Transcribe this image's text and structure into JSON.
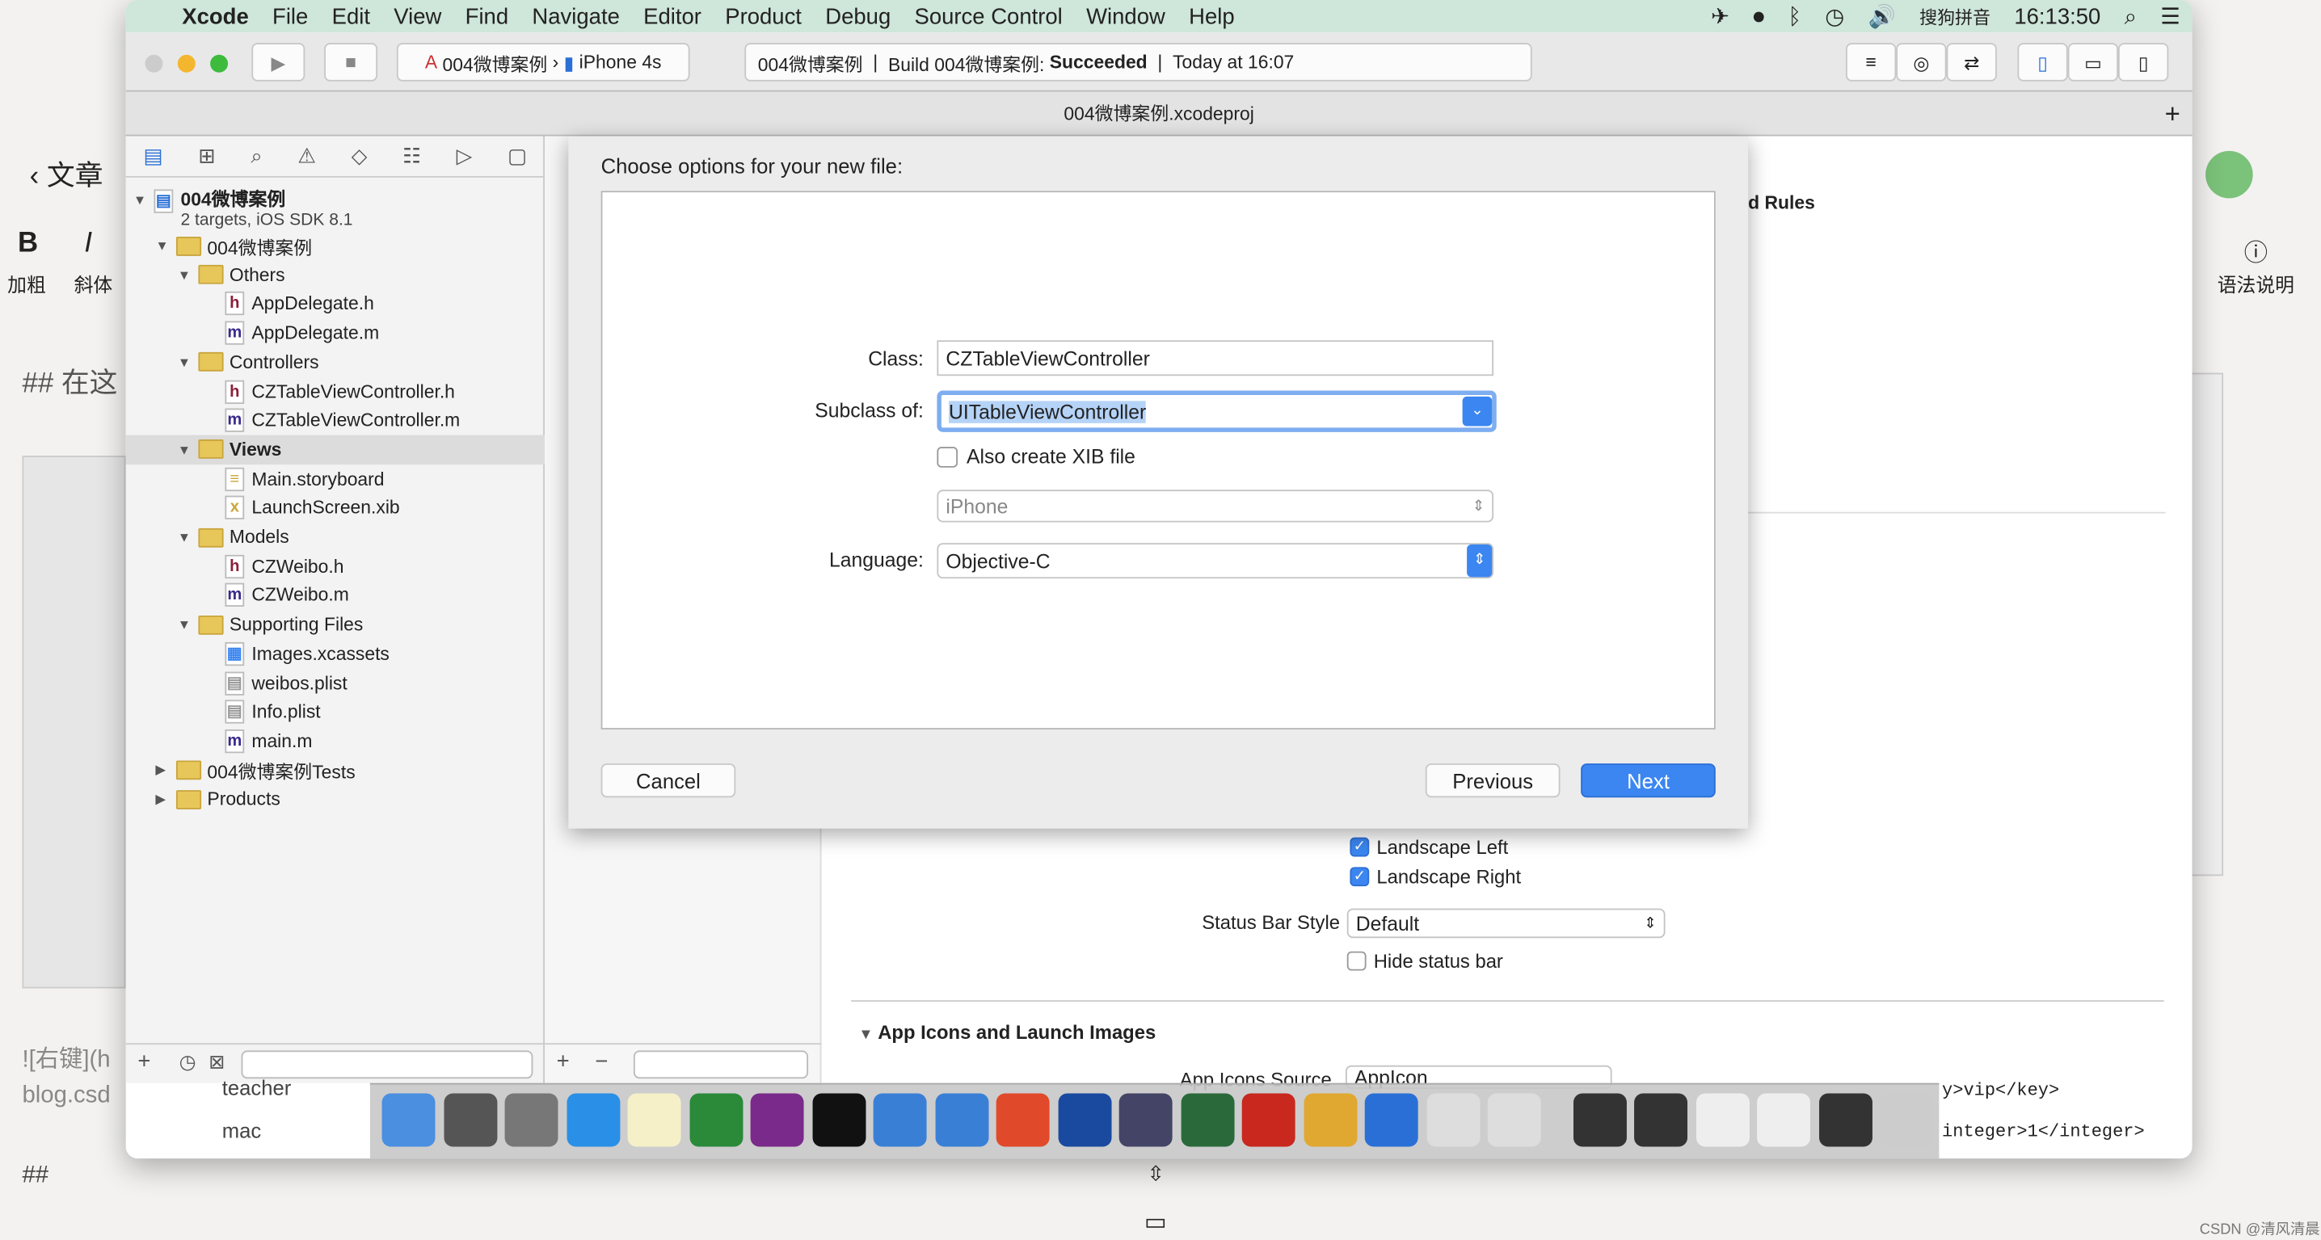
{
  "menubar": {
    "apple": "",
    "items": [
      "Xcode",
      "File",
      "Edit",
      "View",
      "Find",
      "Navigate",
      "Editor",
      "Product",
      "Debug",
      "Source Control",
      "Window",
      "Help"
    ],
    "input_method": "搜狗拼音",
    "clock": "16:13:50"
  },
  "toolbar": {
    "scheme": "004微博案例",
    "device": "iPhone 4s",
    "status_project": "004微博案例",
    "status_build": "Build 004微博案例:",
    "status_result": "Succeeded",
    "status_time": "Today at 16:07"
  },
  "window_title": "004微博案例.xcodeproj",
  "navigator": {
    "project": "004微博案例",
    "project_sub": "2 targets, iOS SDK 8.1",
    "items": [
      {
        "label": "004微博案例",
        "type": "folder",
        "level": 1,
        "open": true
      },
      {
        "label": "Others",
        "type": "folder",
        "level": 2,
        "open": true
      },
      {
        "label": "AppDelegate.h",
        "type": "h",
        "level": 3
      },
      {
        "label": "AppDelegate.m",
        "type": "m",
        "level": 3
      },
      {
        "label": "Controllers",
        "type": "folder",
        "level": 2,
        "open": true
      },
      {
        "label": "CZTableViewController.h",
        "type": "h",
        "level": 3
      },
      {
        "label": "CZTableViewController.m",
        "type": "m",
        "level": 3
      },
      {
        "label": "Views",
        "type": "folder",
        "level": 2,
        "open": true,
        "selected": true
      },
      {
        "label": "Main.storyboard",
        "type": "sb",
        "level": 3
      },
      {
        "label": "LaunchScreen.xib",
        "type": "xib",
        "level": 3
      },
      {
        "label": "Models",
        "type": "folder",
        "level": 2,
        "open": true
      },
      {
        "label": "CZWeibo.h",
        "type": "h",
        "level": 3
      },
      {
        "label": "CZWeibo.m",
        "type": "m",
        "level": 3
      },
      {
        "label": "Supporting Files",
        "type": "folder",
        "level": 2,
        "open": true
      },
      {
        "label": "Images.xcassets",
        "type": "assets",
        "level": 3
      },
      {
        "label": "weibos.plist",
        "type": "plist",
        "level": 3
      },
      {
        "label": "Info.plist",
        "type": "plist",
        "level": 3
      },
      {
        "label": "main.m",
        "type": "m",
        "level": 3
      },
      {
        "label": "004微博案例Tests",
        "type": "folder",
        "level": 1,
        "open": false
      },
      {
        "label": "Products",
        "type": "folder",
        "level": 1,
        "open": false
      }
    ]
  },
  "sheet": {
    "title": "Choose options for your new file:",
    "class_label": "Class:",
    "class_value": "CZTableViewController",
    "subclass_label": "Subclass of:",
    "subclass_value": "UITableViewController",
    "xib_label": "Also create XIB file",
    "xib_checked": false,
    "device_value": "iPhone",
    "language_label": "Language:",
    "language_value": "Objective-C",
    "cancel": "Cancel",
    "previous": "Previous",
    "next": "Next"
  },
  "editor": {
    "build_rules_fragment": "d Rules",
    "landscape_left": "Landscape Left",
    "landscape_right": "Landscape Right",
    "status_bar_style_label": "Status Bar Style",
    "status_bar_style_value": "Default",
    "hide_status_bar": "Hide status bar",
    "section": "App Icons and Launch Images",
    "app_icons_source_label": "App Icons Source",
    "app_icons_source_value": "AppIcon"
  },
  "background": {
    "back": "文章",
    "bold": "B",
    "bold_label": "加粗",
    "italic": "I",
    "italic_label": "斜体",
    "heading": "## 在这",
    "help_label": "语法说明",
    "md1": "![右键](h",
    "md2": "blog.csd",
    "md3": "##",
    "teacher": "teacher",
    "mac": "mac",
    "code1": "y>vip</key>",
    "code2": "integer>1</integer>",
    "watermark": "CSDN @清风清晨"
  },
  "colors": {
    "accent": "#3b86f0",
    "menubar": "#cfe6da"
  }
}
